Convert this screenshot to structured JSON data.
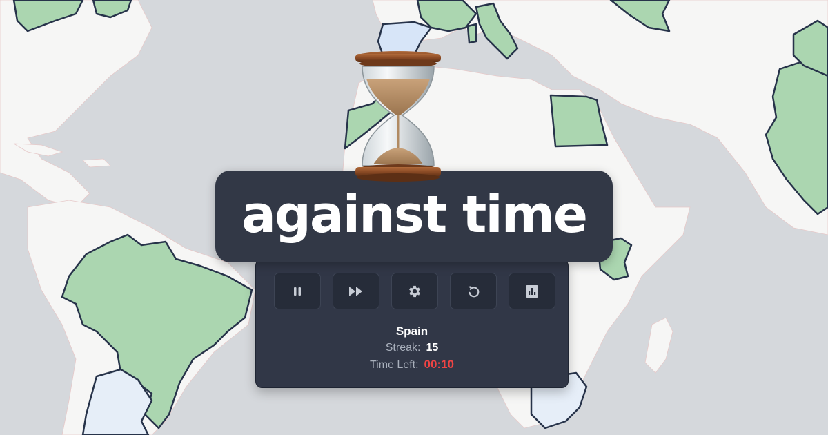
{
  "banner": {
    "title": "against time",
    "hourglass_icon": "hourglass-icon"
  },
  "controls": {
    "pause_icon": "pause-icon",
    "skip_icon": "fast-forward-icon",
    "settings_icon": "gear-icon",
    "restart_icon": "restart-icon",
    "stats_icon": "bar-chart-icon"
  },
  "game": {
    "country": "Spain",
    "streak_label": "Streak:",
    "streak_value": "15",
    "time_label": "Time Left:",
    "time_value": "00:10"
  },
  "colors": {
    "ocean": "#d5d8dc",
    "land": "#f6f6f5",
    "correct_country": "#abd6b0",
    "target_country": "#d7e5f8",
    "panel": "#313747",
    "timer": "#ef4444"
  }
}
